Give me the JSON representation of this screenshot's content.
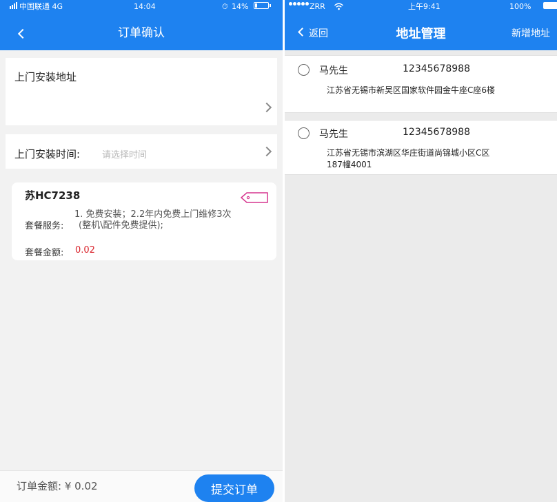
{
  "left": {
    "status": {
      "carrier": "中国联通 4G",
      "time": "14:04",
      "battery": "14%",
      "battery_level": 0.14
    },
    "nav": {
      "title": "订单确认",
      "back_icon": "chevron-left-icon"
    },
    "address_section": {
      "label": "上门安装地址",
      "icon": "chevron-right-icon"
    },
    "time_section": {
      "label": "上门安装时间:",
      "placeholder": "请选择时间",
      "icon": "chevron-right-icon"
    },
    "package": {
      "plate": "苏HC7238",
      "tag_icon": "tag-icon",
      "service_label": "套餐服务:",
      "service_lines": [
        "1. 免费安装；2.2年内免费上门维修3次",
        "(整机\\配件免费提供);"
      ],
      "amount_label": "套餐金额:",
      "amount_value": "0.02"
    },
    "footer": {
      "order_amount": "订单金额: ¥ 0.02",
      "submit_label": "提交订单"
    }
  },
  "right": {
    "status": {
      "carrier": "ZRR",
      "time": "上午9:41",
      "battery": "100%"
    },
    "nav": {
      "back_label": "返回",
      "title": "地址管理",
      "add_label": "新增地址"
    },
    "addresses": [
      {
        "name": "马先生",
        "phone": "12345678988",
        "detail_lines": [
          "江苏省无锡市新吴区国家软件园金牛座C座6楼"
        ],
        "selected": false
      },
      {
        "name": "马先生",
        "phone": "12345678988",
        "detail_lines": [
          "江苏省无锡市滨湖区华庄街道尚锦城小区C区",
          "187幢4001"
        ],
        "selected": false
      }
    ]
  },
  "colors": {
    "primary": "#1e82f0",
    "price": "#d9232b",
    "tag": "#d6368f"
  }
}
